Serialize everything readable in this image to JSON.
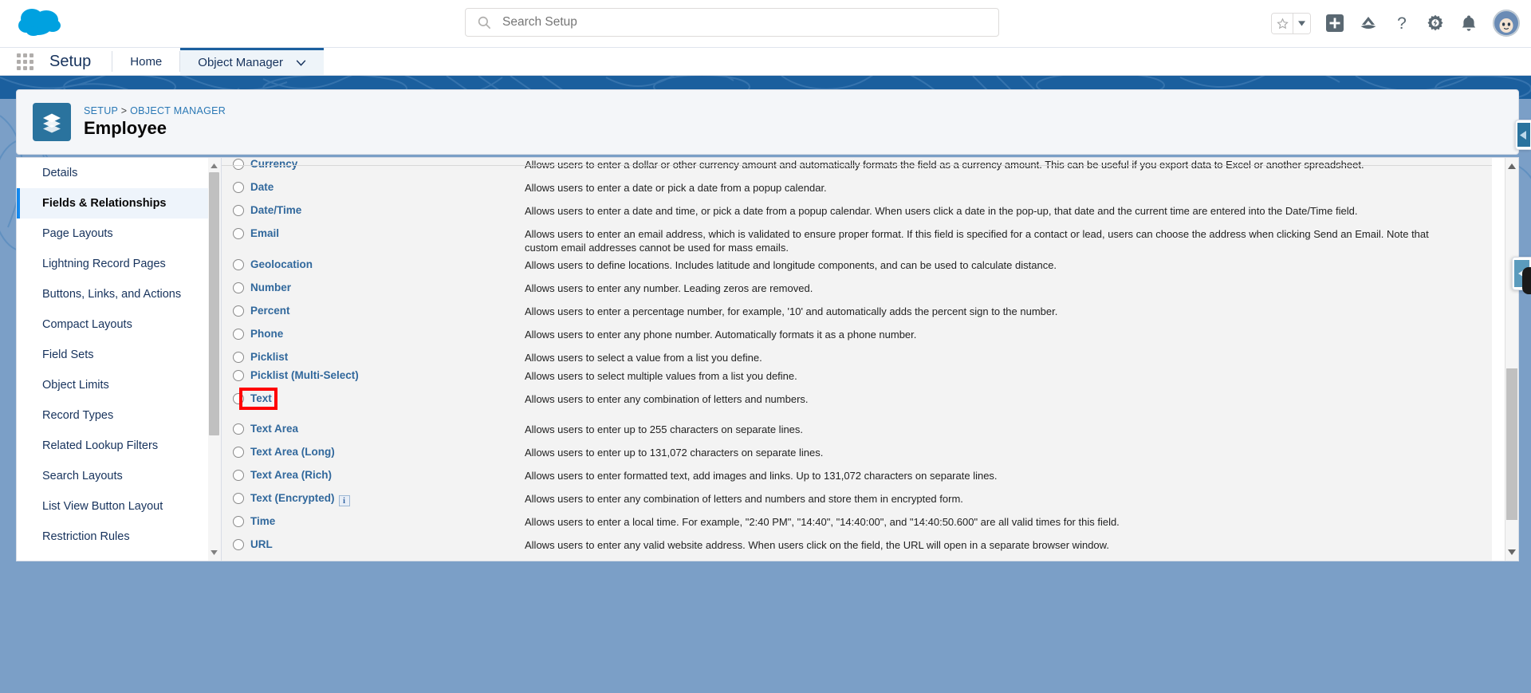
{
  "header": {
    "logo_name": "salesforce-cloud-logo",
    "search": {
      "placeholder": "Search Setup",
      "value": ""
    },
    "icons": [
      {
        "name": "favorites-star-icon",
        "glyph": "star"
      },
      {
        "name": "favorites-dropdown-icon",
        "glyph": "caret-down"
      },
      {
        "name": "global-actions-icon",
        "glyph": "plus-square"
      },
      {
        "name": "trailhead-icon",
        "glyph": "mountain"
      },
      {
        "name": "help-icon",
        "glyph": "question"
      },
      {
        "name": "setup-gear-icon",
        "glyph": "gear"
      },
      {
        "name": "notifications-bell-icon",
        "glyph": "bell"
      },
      {
        "name": "user-avatar",
        "glyph": "astro"
      }
    ]
  },
  "setup_bar": {
    "app_launcher_label": "App Launcher",
    "title": "Setup",
    "tabs": [
      {
        "label": "Home",
        "active": false,
        "has_caret": false
      },
      {
        "label": "Object Manager",
        "active": true,
        "has_caret": true
      }
    ]
  },
  "record_header": {
    "breadcrumb_items": [
      "SETUP",
      "OBJECT MANAGER"
    ],
    "breadcrumb_separator": ">",
    "object_name": "Employee",
    "object_icon": "layers-icon"
  },
  "sidebar": {
    "items": [
      {
        "label": "Details",
        "active": false
      },
      {
        "label": "Fields & Relationships",
        "active": true
      },
      {
        "label": "Page Layouts",
        "active": false
      },
      {
        "label": "Lightning Record Pages",
        "active": false
      },
      {
        "label": "Buttons, Links, and Actions",
        "active": false
      },
      {
        "label": "Compact Layouts",
        "active": false
      },
      {
        "label": "Field Sets",
        "active": false
      },
      {
        "label": "Object Limits",
        "active": false
      },
      {
        "label": "Record Types",
        "active": false
      },
      {
        "label": "Related Lookup Filters",
        "active": false
      },
      {
        "label": "Search Layouts",
        "active": false
      },
      {
        "label": "List View Button Layout",
        "active": false
      },
      {
        "label": "Restriction Rules",
        "active": false
      }
    ]
  },
  "data_type_options": [
    {
      "label": "Currency",
      "description": "Allows users to enter a dollar or other currency amount and automatically formats the field as a currency amount. This can be useful if you export data to Excel or another spreadsheet.",
      "selected": false,
      "highlighted": false,
      "info": false
    },
    {
      "label": "Date",
      "description": "Allows users to enter a date or pick a date from a popup calendar.",
      "selected": false,
      "highlighted": false,
      "info": false
    },
    {
      "label": "Date/Time",
      "description": "Allows users to enter a date and time, or pick a date from a popup calendar. When users click a date in the pop-up, that date and the current time are entered into the Date/Time field.",
      "selected": false,
      "highlighted": false,
      "info": false
    },
    {
      "label": "Email",
      "description": "Allows users to enter an email address, which is validated to ensure proper format. If this field is specified for a contact or lead, users can choose the address when clicking Send an Email. Note that custom email addresses cannot be used for mass emails.",
      "selected": false,
      "highlighted": false,
      "info": false
    },
    {
      "label": "Geolocation",
      "description": "Allows users to define locations. Includes latitude and longitude components, and can be used to calculate distance.",
      "selected": false,
      "highlighted": false,
      "info": false
    },
    {
      "label": "Number",
      "description": "Allows users to enter any number. Leading zeros are removed.",
      "selected": false,
      "highlighted": false,
      "info": false
    },
    {
      "label": "Percent",
      "description": "Allows users to enter a percentage number, for example, '10' and automatically adds the percent sign to the number.",
      "selected": false,
      "highlighted": false,
      "info": false
    },
    {
      "label": "Phone",
      "description": "Allows users to enter any phone number. Automatically formats it as a phone number.",
      "selected": false,
      "highlighted": false,
      "info": false
    },
    {
      "label": "Picklist",
      "description": "Allows users to select a value from a list you define.",
      "selected": false,
      "highlighted": false,
      "info": false
    },
    {
      "label": "Picklist (Multi-Select)",
      "description": "Allows users to select multiple values from a list you define.",
      "selected": false,
      "highlighted": false,
      "info": false
    },
    {
      "label": "Text",
      "description": "Allows users to enter any combination of letters and numbers.",
      "selected": false,
      "highlighted": true,
      "info": false
    },
    {
      "label": "Text Area",
      "description": "Allows users to enter up to 255 characters on separate lines.",
      "selected": false,
      "highlighted": false,
      "info": false
    },
    {
      "label": "Text Area (Long)",
      "description": "Allows users to enter up to 131,072 characters on separate lines.",
      "selected": false,
      "highlighted": false,
      "info": false
    },
    {
      "label": "Text Area (Rich)",
      "description": "Allows users to enter formatted text, add images and links. Up to 131,072 characters on separate lines.",
      "selected": false,
      "highlighted": false,
      "info": false
    },
    {
      "label": "Text (Encrypted)",
      "description": "Allows users to enter any combination of letters and numbers and store them in encrypted form.",
      "selected": false,
      "highlighted": false,
      "info": true,
      "info_label": "i"
    },
    {
      "label": "Time",
      "description": "Allows users to enter a local time. For example, \"2:40 PM\", \"14:40\", \"14:40:00\", and \"14:40:50.600\" are all valid times for this field.",
      "selected": false,
      "highlighted": false,
      "info": false
    },
    {
      "label": "URL",
      "description": "Allows users to enter any valid website address. When users click on the field, the URL will open in a separate browser window.",
      "selected": false,
      "highlighted": false,
      "info": false
    }
  ],
  "colors": {
    "brand_blue": "#1b5f9e",
    "band_blue": "#7b9fc7",
    "link_blue": "#31689c",
    "highlight_red": "#ff0000",
    "active_nav": "#1589ee"
  }
}
